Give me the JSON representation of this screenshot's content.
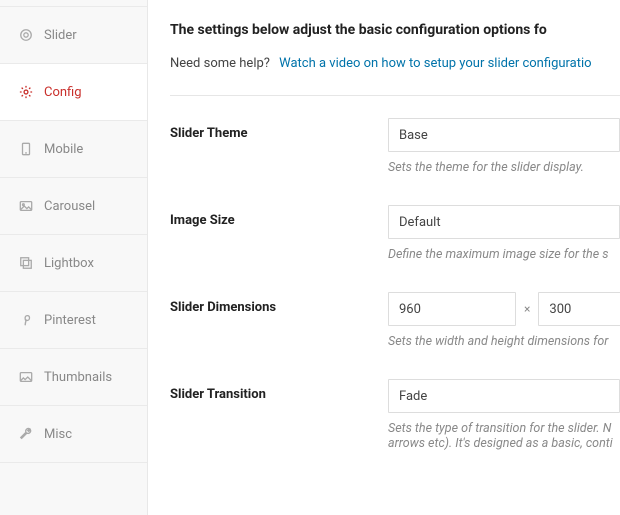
{
  "sidebar": {
    "items": [
      {
        "label": "Slider",
        "icon": "circle"
      },
      {
        "label": "Config",
        "icon": "gear"
      },
      {
        "label": "Mobile",
        "icon": "mobile"
      },
      {
        "label": "Carousel",
        "icon": "image"
      },
      {
        "label": "Lightbox",
        "icon": "layers"
      },
      {
        "label": "Pinterest",
        "icon": "pinterest"
      },
      {
        "label": "Thumbnails",
        "icon": "thumb"
      },
      {
        "label": "Misc",
        "icon": "wrench"
      }
    ]
  },
  "main": {
    "heading": "The settings below adjust the basic configuration options fo",
    "help_text": "Need some help?",
    "help_link": "Watch a video on how to setup your slider configuratio",
    "fields": {
      "theme": {
        "label": "Slider Theme",
        "value": "Base",
        "help": "Sets the theme for the slider display."
      },
      "image_size": {
        "label": "Image Size",
        "value": "Default",
        "help": "Define the maximum image size for the s"
      },
      "dimensions": {
        "label": "Slider Dimensions",
        "width": "960",
        "height": "300",
        "sep": "×",
        "help": "Sets the width and height dimensions for "
      },
      "transition": {
        "label": "Slider Transition",
        "value": "Fade",
        "help": "Sets the type of transition for the slider. N\narrows etc). It's designed as a basic, conti"
      }
    }
  }
}
